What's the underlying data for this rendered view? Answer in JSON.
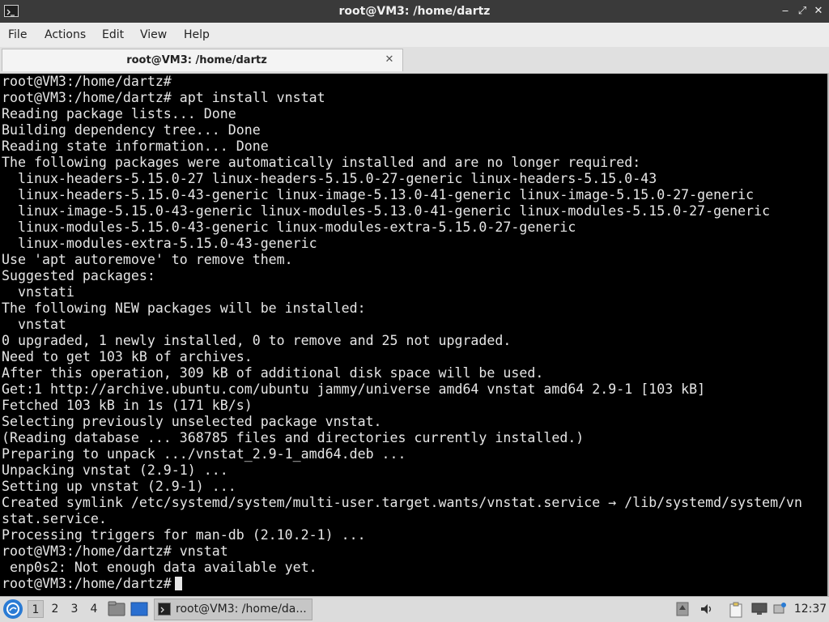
{
  "window": {
    "title": "root@VM3: /home/dartz",
    "minimize_glyph": "‒",
    "maximize_glyph": "⤢",
    "close_glyph": "✕"
  },
  "menubar": {
    "items": [
      {
        "label": "File"
      },
      {
        "label": "Actions"
      },
      {
        "label": "Edit"
      },
      {
        "label": "View"
      },
      {
        "label": "Help"
      }
    ]
  },
  "tabs": [
    {
      "label": "root@VM3: /home/dartz",
      "close_glyph": "✕"
    }
  ],
  "terminal": {
    "lines": [
      "root@VM3:/home/dartz#",
      "root@VM3:/home/dartz# apt install vnstat",
      "Reading package lists... Done",
      "Building dependency tree... Done",
      "Reading state information... Done",
      "The following packages were automatically installed and are no longer required:",
      "  linux-headers-5.15.0-27 linux-headers-5.15.0-27-generic linux-headers-5.15.0-43",
      "  linux-headers-5.15.0-43-generic linux-image-5.13.0-41-generic linux-image-5.15.0-27-generic",
      "  linux-image-5.15.0-43-generic linux-modules-5.13.0-41-generic linux-modules-5.15.0-27-generic",
      "  linux-modules-5.15.0-43-generic linux-modules-extra-5.15.0-27-generic",
      "  linux-modules-extra-5.15.0-43-generic",
      "Use 'apt autoremove' to remove them.",
      "Suggested packages:",
      "  vnstati",
      "The following NEW packages will be installed:",
      "  vnstat",
      "0 upgraded, 1 newly installed, 0 to remove and 25 not upgraded.",
      "Need to get 103 kB of archives.",
      "After this operation, 309 kB of additional disk space will be used.",
      "Get:1 http://archive.ubuntu.com/ubuntu jammy/universe amd64 vnstat amd64 2.9-1 [103 kB]",
      "Fetched 103 kB in 1s (171 kB/s)",
      "Selecting previously unselected package vnstat.",
      "(Reading database ... 368785 files and directories currently installed.)",
      "Preparing to unpack .../vnstat_2.9-1_amd64.deb ...",
      "Unpacking vnstat (2.9-1) ...",
      "Setting up vnstat (2.9-1) ...",
      "Created symlink /etc/systemd/system/multi-user.target.wants/vnstat.service → /lib/systemd/system/vn",
      "stat.service.",
      "Processing triggers for man-db (2.10.2-1) ...",
      "root@VM3:/home/dartz# vnstat",
      " enp0s2: Not enough data available yet."
    ],
    "prompt": "root@VM3:/home/dartz#"
  },
  "taskbar": {
    "workspaces": [
      {
        "label": "1",
        "active": true
      },
      {
        "label": "2",
        "active": false
      },
      {
        "label": "3",
        "active": false
      },
      {
        "label": "4",
        "active": false
      }
    ],
    "launchers": [
      "file-manager-icon",
      "desktop-icon"
    ],
    "tasks": [
      {
        "label": "root@VM3: /home/da...",
        "icon": "terminal-icon"
      }
    ],
    "tray": [
      "update-notifier-icon",
      "volume-icon",
      "clipboard-icon",
      "network-icon"
    ],
    "clock": "12:37"
  },
  "colors": {
    "terminal_bg": "#000000",
    "terminal_fg": "#e6e6e6",
    "titlebar_bg": "#3a3a3a",
    "accent": "#2a7bd4"
  }
}
